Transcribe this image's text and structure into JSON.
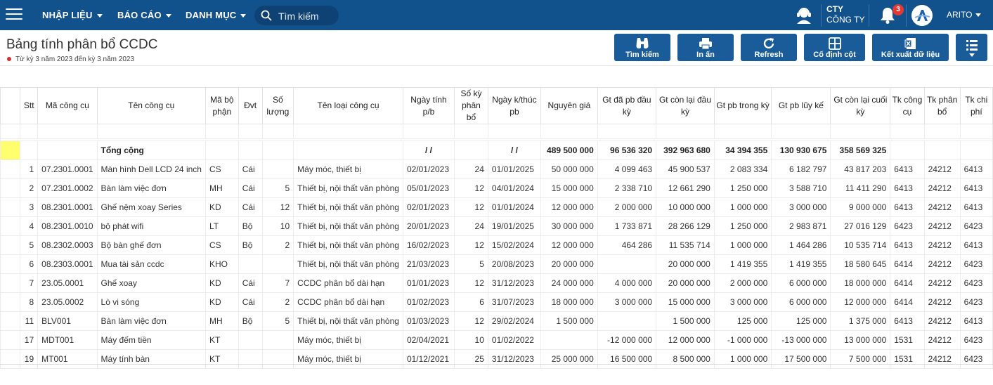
{
  "nav": {
    "menus": [
      {
        "label": "NHẬP LIỆU"
      },
      {
        "label": "BÁO CÁO"
      },
      {
        "label": "DANH MỤC"
      }
    ],
    "search_placeholder": "Tìm kiếm",
    "company_line1": "CTY",
    "company_line2": "CÔNG TY",
    "notification_count": "3",
    "user_name": "ARITO",
    "colors": {
      "bar": "#12528c",
      "badge": "#e53935"
    }
  },
  "header": {
    "title": "Bảng tính phân bổ CCDC",
    "subtitle": "Từ kỳ 3 năm 2023 đến kỳ 3 năm 2023"
  },
  "toolbar": {
    "search_label": "Tìm kiếm",
    "print_label": "In ấn",
    "refresh_label": "Refresh",
    "freeze_label": "Cố định cột",
    "export_label": "Kết xuất dữ liệu",
    "button_color": "#1a5c99"
  },
  "table": {
    "columns": [
      "Stt",
      "Mã công cụ",
      "Tên công cụ",
      "Mã bộ phận",
      "Đvt",
      "Số lượng",
      "Tên loại công cụ",
      "Ngày tính p/b",
      "Số kỳ phân bổ",
      "Ngày k/thúc pb",
      "Nguyên giá",
      "Gt đã pb đầu kỳ",
      "Gt còn lại đầu kỳ",
      "Gt pb trong kỳ",
      "Gt pb lũy kế",
      "Gt còn lại cuối kỳ",
      "Tk công cụ",
      "Tk phân bổ",
      "Tk chi phí"
    ],
    "total": {
      "label": "Tổng cộng",
      "date_start": "/ /",
      "date_end": "/ /",
      "nguyen_gia": "489 500 000",
      "gt_da_pb": "96 536 320",
      "gt_con_lai_dau": "392 963 680",
      "gt_pb_trong_ky": "34 394 355",
      "gt_pb_luy_ke": "130 930 675",
      "gt_con_lai_cuoi": "358 569 325"
    },
    "rows": [
      [
        "1",
        "07.2301.0001",
        "Màn hình Dell LCD 24 inch",
        "CS",
        "Cái",
        "",
        "Máy móc, thiết bị",
        "02/01/2023",
        "24",
        "01/01/2025",
        "50 000 000",
        "4 099 463",
        "45 900 537",
        "2 083 334",
        "6 182 797",
        "43 817 203",
        "6413",
        "24212",
        "6413"
      ],
      [
        "2",
        "07.2301.0002",
        "Bàn làm việc đơn",
        "MH",
        "Cái",
        "5",
        "Thiết bị, nội thất văn phòng",
        "05/01/2023",
        "12",
        "04/01/2024",
        "15 000 000",
        "2 338 710",
        "12 661 290",
        "1 250 000",
        "3 588 710",
        "11 411 290",
        "6413",
        "24212",
        "6413"
      ],
      [
        "3",
        "08.2301.0001",
        "Ghế nệm xoay Series",
        "KD",
        "Cái",
        "12",
        "Thiết bị, nội thất văn phòng",
        "02/01/2023",
        "12",
        "01/01/2024",
        "12 000 000",
        "2 000 000",
        "10 000 000",
        "1 000 000",
        "3 000 000",
        "9 000 000",
        "6413",
        "24212",
        "6413"
      ],
      [
        "4",
        "08.2301.0010",
        "bộ phát wifi",
        "LT",
        "Bộ",
        "10",
        "Thiết bị, nội thất văn phòng",
        "20/01/2023",
        "24",
        "19/01/2025",
        "30 000 000",
        "1 733 871",
        "28 266 129",
        "1 250 000",
        "2 983 871",
        "27 016 129",
        "6423",
        "24212",
        "6423"
      ],
      [
        "5",
        "08.2302.0003",
        "Bộ bàn ghế đơn",
        "CS",
        "Bộ",
        "2",
        "Thiết bị, nội thất văn phòng",
        "16/02/2023",
        "12",
        "15/02/2024",
        "12 000 000",
        "464 286",
        "11 535 714",
        "1 000 000",
        "1 464 286",
        "10 535 714",
        "6413",
        "24212",
        "6413"
      ],
      [
        "6",
        "08.2303.0001",
        "Mua tài sản ccdc",
        "KHO",
        "",
        "",
        "Thiết bị, nội thất văn phòng",
        "21/03/2023",
        "5",
        "20/08/2023",
        "20 000 000",
        "",
        "20 000 000",
        "1 419 355",
        "1 419 355",
        "18 580 645",
        "6414",
        "24212",
        "6423"
      ],
      [
        "7",
        "23.05.0001",
        "Ghế xoay",
        "KD",
        "Cái",
        "7",
        "CCDC phân bổ dài hạn",
        "01/01/2023",
        "12",
        "31/12/2023",
        "24 000 000",
        "4 000 000",
        "20 000 000",
        "2 000 000",
        "6 000 000",
        "18 000 000",
        "6414",
        "24212",
        "6423"
      ],
      [
        "8",
        "23.05.0002",
        "Lò vi sóng",
        "KD",
        "Cái",
        "2",
        "CCDC phân bổ dài hạn",
        "01/02/2023",
        "6",
        "31/07/2023",
        "18 000 000",
        "3 000 000",
        "15 000 000",
        "3 000 000",
        "6 000 000",
        "12 000 000",
        "6414",
        "24212",
        "6423"
      ],
      [
        "11",
        "BLV001",
        "Bàn làm việc đơn",
        "MH",
        "Bộ",
        "5",
        "Thiết bị, nội thất văn phòng",
        "01/03/2023",
        "12",
        "29/02/2024",
        "1 500 000",
        "",
        "1 500 000",
        "125 000",
        "125 000",
        "1 375 000",
        "6413",
        "24212",
        "6413"
      ],
      [
        "17",
        "MDT001",
        "Máy đếm tiền",
        "KT",
        "",
        "",
        "Máy móc, thiết bị",
        "02/04/2021",
        "10",
        "01/02/2022",
        "",
        "-12 000 000",
        "12 000 000",
        "-1 000 000",
        "-13 000 000",
        "13 000 000",
        "1531",
        "24212",
        "6423"
      ],
      [
        "19",
        "MT001",
        "Máy tính bàn",
        "KT",
        "",
        "",
        "Máy móc, thiết bị",
        "01/12/2021",
        "25",
        "31/12/2023",
        "25 000 000",
        "16 500 000",
        "8 500 000",
        "1 000 000",
        "17 500 000",
        "7 500 000",
        "1531",
        "24212",
        "6423"
      ]
    ]
  }
}
